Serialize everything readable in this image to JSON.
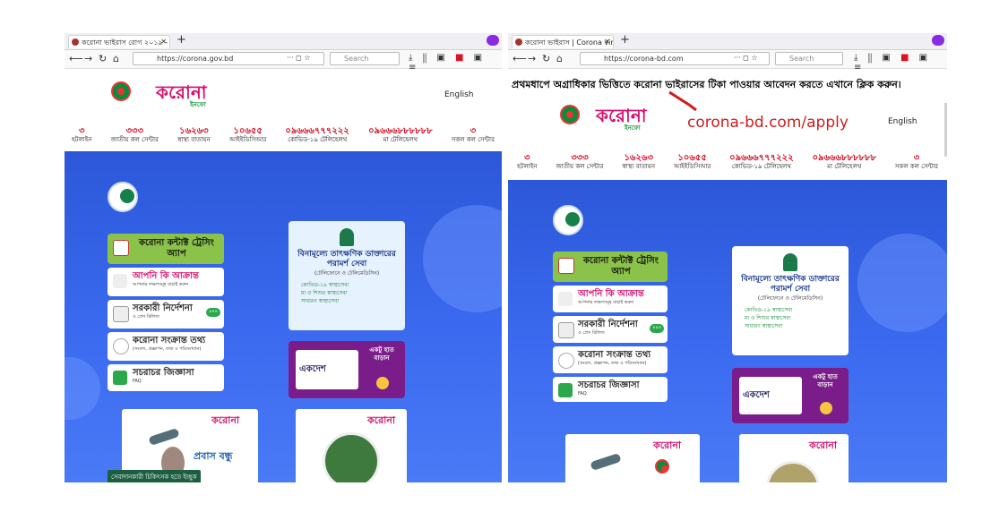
{
  "left": {
    "tab_title": "করোনা ভাইরাস রোগ ২০১৯ - Co",
    "url": "https://corona.gov.bd",
    "search_placeholder": "Search",
    "logo_text": "করোনা",
    "logo_sub": "ইনফো",
    "language": "English"
  },
  "right": {
    "tab_title": "করোনা ভাইরাস | Corona virus",
    "url": "https://corona-bd.com",
    "search_placeholder": "Search",
    "notice": "প্রথমধাপে অগ্রাধিকার ভিত্তিতে করোনা ভাইরাসের টিকা পাওয়ার আবেদন করতে এখানে ক্লিক করুন।",
    "apply_link": "corona-bd.com/apply",
    "logo_text": "করোনা",
    "logo_sub": "ইনফো",
    "language": "English"
  },
  "hotlines": [
    {
      "num": "৩",
      "label": "হটলাইন"
    },
    {
      "num": "৩৩৩",
      "label": "জাতীয় কল সেন্টার"
    },
    {
      "num": "১৬২৬৩",
      "label": "স্বাস্থ্য বাতায়ন"
    },
    {
      "num": "১০৬৫৫",
      "label": "আইইডিসিআর"
    },
    {
      "num": "০৯৬৬৬৭৭৭২২২",
      "label": "কোভিড-১৯ টেলিহেলথ"
    },
    {
      "num": "০৯৬৬৬৮৮৮৮৮৮",
      "label": "মা টেলিহেলথ"
    },
    {
      "num": "৩",
      "label": "সকল কল সেন্টার"
    }
  ],
  "menu": {
    "contact_tracing": "করোনা কন্টাক্ট ট্রেসিং অ্যাপ",
    "am_i_affected": "আপনি কি আক্রান্ত",
    "am_i_affected_sub": "আপনার লক্ষণসমূহ যাচাই করুন",
    "govt_directives": "সরকারী নির্দেশনা",
    "govt_directives_sub": "ও প্রেস রিলিজ",
    "badge": "৪৪৪",
    "corona_info": "করোনা সংক্রান্ত তথ্য",
    "corona_info_sub": "(সংবাদ, প্রজ্ঞাপন, তথ্য ও পরিসংখ্যান)",
    "faq": "সচরাচর জিজ্ঞাসা",
    "faq_sub": "FAQ"
  },
  "doctor_card": {
    "title": "বিনামূল্যে তাৎক্ষণিক ডাক্তারের পরামর্শ সেবা",
    "subtitle": "(টেলিফোনে ও টেলিমেডিসিন)",
    "items": [
      "কোভিড-১৯ স্বাস্থ্যসেবা",
      "মা ও শিশুর স্বাস্থ্যসেবা",
      "সাধারণ স্বাস্থ্যসেবা"
    ]
  },
  "ekdesh": {
    "brand": "একদেশ",
    "label": "একটু হাত বাড়ান"
  },
  "promo": {
    "logo": "করোনা",
    "probash": "প্রবাস বন্ধু",
    "banner": "সেবাদানকারী চিকিৎসক হতে ইচ্ছুক"
  },
  "colors": {
    "hero_blue": "#3b6af0",
    "accent_pink": "#d6106e",
    "hotline_red": "#d0021b",
    "green": "#8bc34a",
    "purple": "#7a1d8a"
  }
}
